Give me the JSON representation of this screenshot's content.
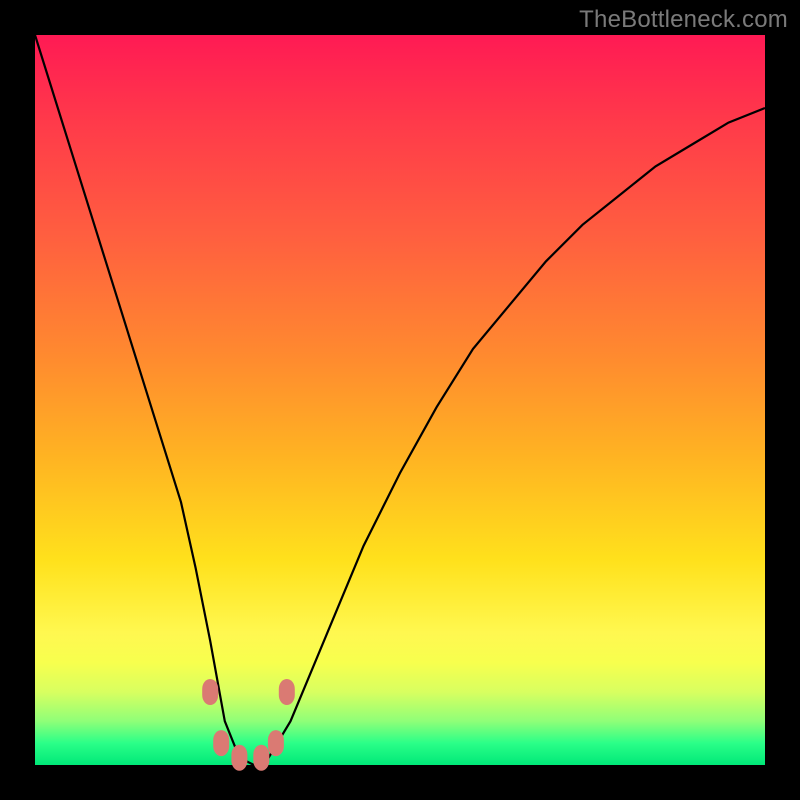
{
  "watermark": "TheBottleneck.com",
  "colors": {
    "curve": "#000000",
    "marker": "#da7a73",
    "frame": "#000000"
  },
  "chart_data": {
    "type": "line",
    "title": "",
    "xlabel": "",
    "ylabel": "",
    "xlim": [
      0,
      100
    ],
    "ylim": [
      0,
      100
    ],
    "grid": false,
    "legend": false,
    "description": "V-shaped bottleneck curve over vertical heatmap gradient (red=high bottleneck, green=low). Minimum of curve touches green band.",
    "series": [
      {
        "name": "bottleneck-curve",
        "x": [
          0,
          5,
          10,
          15,
          20,
          22,
          24,
          26,
          28,
          30,
          32,
          35,
          40,
          45,
          50,
          55,
          60,
          65,
          70,
          75,
          80,
          85,
          90,
          95,
          100
        ],
        "y": [
          100,
          84,
          68,
          52,
          36,
          27,
          17,
          6,
          1,
          0,
          1,
          6,
          18,
          30,
          40,
          49,
          57,
          63,
          69,
          74,
          78,
          82,
          85,
          88,
          90
        ]
      }
    ],
    "markers": [
      {
        "x": 24,
        "y": 10
      },
      {
        "x": 25.5,
        "y": 3
      },
      {
        "x": 28,
        "y": 1
      },
      {
        "x": 31,
        "y": 1
      },
      {
        "x": 33,
        "y": 3
      },
      {
        "x": 34.5,
        "y": 10
      }
    ],
    "gradient_bands": [
      {
        "color": "#ff1a54",
        "value": 100
      },
      {
        "color": "#ff8a2f",
        "value": 60
      },
      {
        "color": "#ffe11c",
        "value": 30
      },
      {
        "color": "#f7ff4e",
        "value": 14
      },
      {
        "color": "#2bff88",
        "value": 3
      },
      {
        "color": "#00e878",
        "value": 0
      }
    ]
  }
}
